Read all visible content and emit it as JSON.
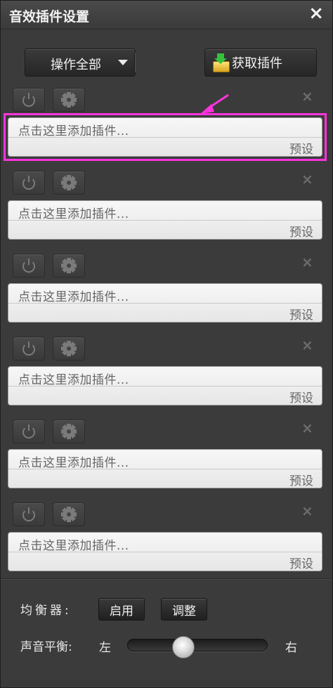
{
  "window": {
    "title": "音效插件设置",
    "close_icon": "×"
  },
  "toolbar": {
    "operate_all_label": "操作全部",
    "get_plugin_label": "获取插件"
  },
  "slots": [
    {
      "placeholder": "点击这里添加插件...",
      "preset_label": "预设",
      "remove_icon": "×"
    },
    {
      "placeholder": "点击这里添加插件...",
      "preset_label": "预设",
      "remove_icon": "×"
    },
    {
      "placeholder": "点击这里添加插件...",
      "preset_label": "预设",
      "remove_icon": "×"
    },
    {
      "placeholder": "点击这里添加插件...",
      "preset_label": "预设",
      "remove_icon": "×"
    },
    {
      "placeholder": "点击这里添加插件...",
      "preset_label": "预设",
      "remove_icon": "×"
    },
    {
      "placeholder": "点击这里添加插件...",
      "preset_label": "预设",
      "remove_icon": "×"
    }
  ],
  "equalizer": {
    "label": "均衡器:",
    "enable_label": "启用",
    "adjust_label": "调整"
  },
  "balance": {
    "label": "声音平衡:",
    "left_label": "左",
    "right_label": "右",
    "value": 0.4
  },
  "colors": {
    "highlight": "#ff33dd",
    "background": "#3b3b3b"
  }
}
